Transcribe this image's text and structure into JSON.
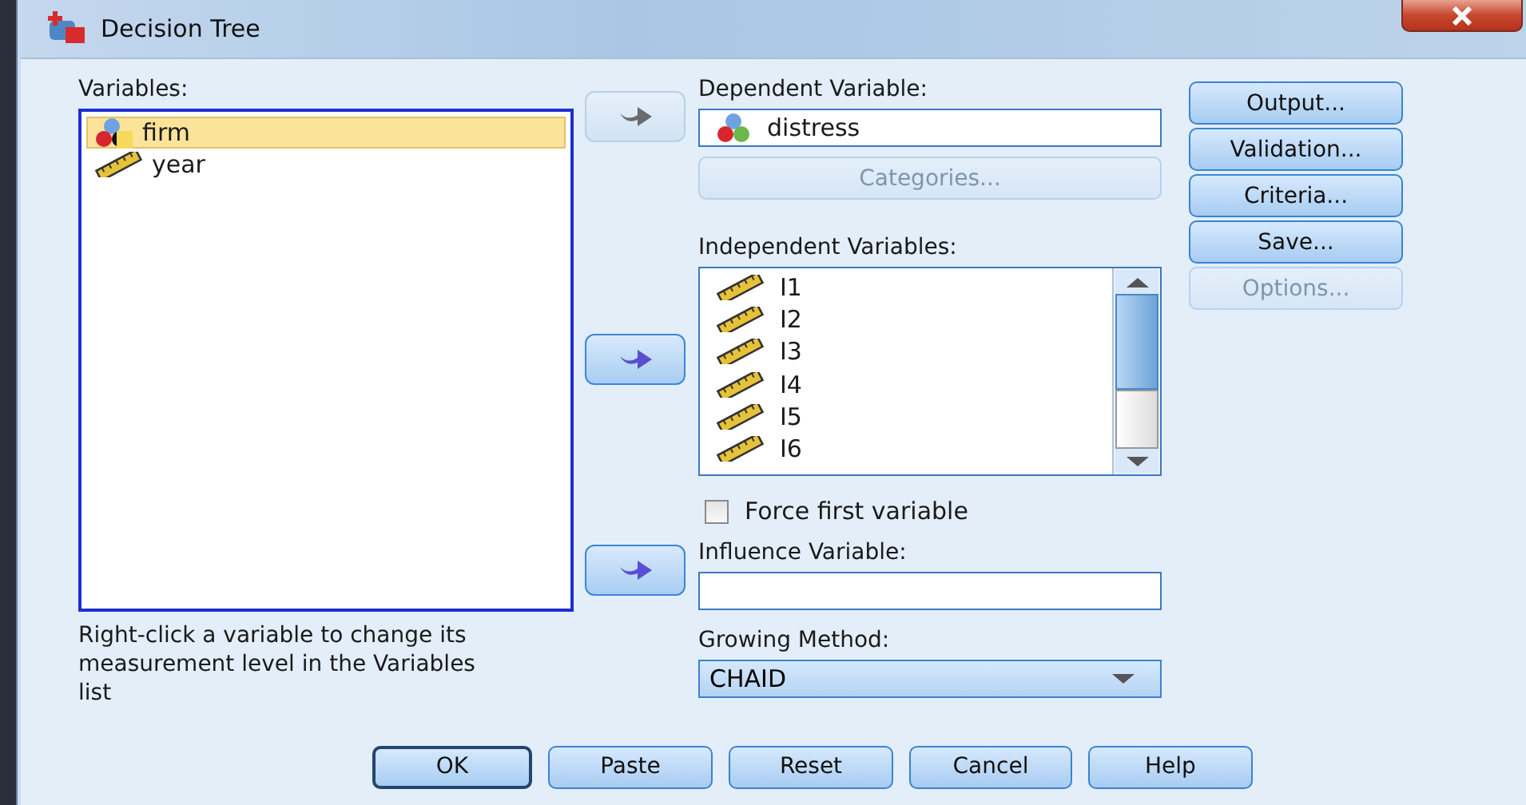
{
  "window": {
    "title": "Decision Tree"
  },
  "variables": {
    "label": "Variables:",
    "items": [
      {
        "name": "firm",
        "kind": "string",
        "selected": true
      },
      {
        "name": "year",
        "kind": "scale",
        "selected": false
      }
    ]
  },
  "hint": "Right-click a variable to change its measurement level in the Variables list",
  "arrows": [
    {
      "disabled": true
    },
    {
      "disabled": false
    },
    {
      "disabled": false
    }
  ],
  "dependent": {
    "label": "Dependent Variable:",
    "value": {
      "name": "distress",
      "kind": "nominal"
    }
  },
  "categories_button": {
    "label": "Categories...",
    "disabled": true
  },
  "independent": {
    "label": "Independent Variables:",
    "items": [
      {
        "name": "I1",
        "kind": "scale"
      },
      {
        "name": "I2",
        "kind": "scale"
      },
      {
        "name": "I3",
        "kind": "scale"
      },
      {
        "name": "I4",
        "kind": "scale"
      },
      {
        "name": "I5",
        "kind": "scale"
      },
      {
        "name": "I6",
        "kind": "scale"
      }
    ]
  },
  "force_first": {
    "label": "Force first variable",
    "checked": false
  },
  "influence": {
    "label": "Influence Variable:"
  },
  "growing": {
    "label": "Growing Method:",
    "value": "CHAID"
  },
  "side_buttons": [
    {
      "label": "Output...",
      "disabled": false
    },
    {
      "label": "Validation...",
      "disabled": false
    },
    {
      "label": "Criteria...",
      "disabled": false
    },
    {
      "label": "Save...",
      "disabled": false
    },
    {
      "label": "Options...",
      "disabled": true
    }
  ],
  "bottom_buttons": [
    {
      "label": "OK",
      "default": true
    },
    {
      "label": "Paste",
      "default": false
    },
    {
      "label": "Reset",
      "default": false
    },
    {
      "label": "Cancel",
      "default": false
    },
    {
      "label": "Help",
      "default": false
    }
  ]
}
